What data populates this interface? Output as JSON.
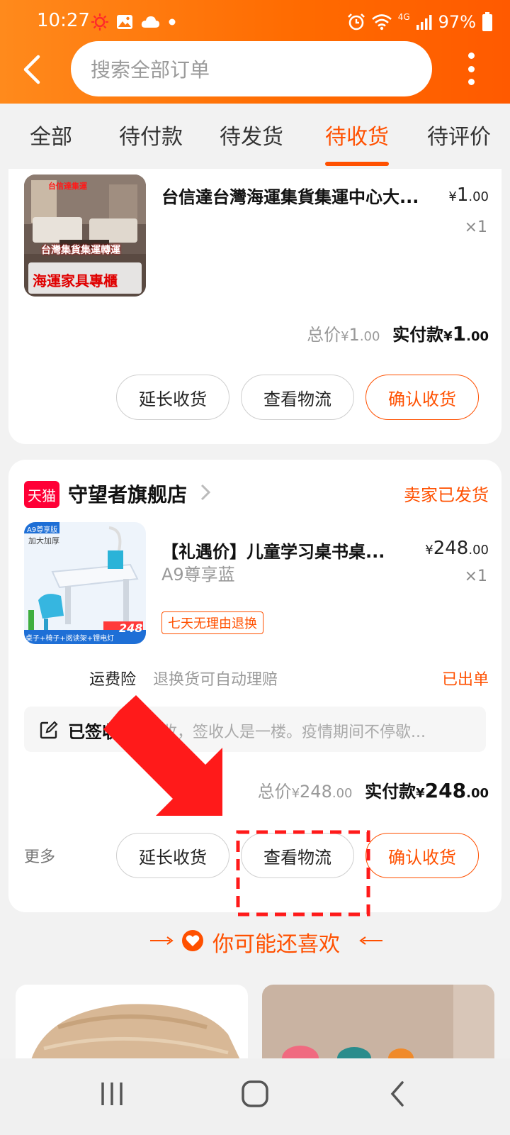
{
  "status_bar": {
    "time": "10:27",
    "battery": "97%",
    "network": "4G",
    "icons": [
      "sun-icon",
      "gallery-icon",
      "cloud-icon",
      "dot-icon",
      "alarm-icon",
      "wifi-icon",
      "signal-icon",
      "battery-icon"
    ]
  },
  "header": {
    "search_placeholder": "搜索全部订单",
    "icons": [
      "back-arrow-icon",
      "more-vertical-icon"
    ]
  },
  "tabs": [
    {
      "label": "全部",
      "active": false
    },
    {
      "label": "待付款",
      "active": false
    },
    {
      "label": "待发货",
      "active": false
    },
    {
      "label": "待收货",
      "active": true
    },
    {
      "label": "待评价",
      "active": false
    }
  ],
  "orders": [
    {
      "item": {
        "title": "台信達台灣海運集貨集運中心大...",
        "price_symbol": "¥",
        "price_int": "1",
        "price_dec": ".00",
        "qty": "×1",
        "image_text": [
          "台信達集運",
          "台灣集貨集運轉運",
          "海運家具專櫃"
        ]
      },
      "total_label": "总价",
      "total_symbol": "¥",
      "total_int": "1",
      "total_dec": ".00",
      "paid_label": "实付款",
      "paid_symbol": "¥",
      "paid_int": "1",
      "paid_dec": ".00",
      "buttons": [
        "延长收货",
        "查看物流",
        "确认收货"
      ]
    },
    {
      "shop_badge": "天猫",
      "shop_name": "守望者旗舰店",
      "status": "卖家已发货",
      "item": {
        "title": "【礼遇价】儿童学习桌书桌...",
        "price_symbol": "¥",
        "price_int": "248",
        "price_dec": ".00",
        "qty": "×1",
        "sku": "A9尊享蓝",
        "tag": "七天无理由退换",
        "image_text": [
          "A9尊享版",
          "加大加厚",
          "248",
          "桌子+椅子+阅读架+锂电灯"
        ]
      },
      "insurance_label": "运费险",
      "insurance_desc": "退换货可自动理赔",
      "insurance_status": "已出单",
      "logistics_status": "已签收",
      "logistics_detail": "已签收，签收人是一楼。疫情期间不停歇...",
      "total_label": "总价",
      "total_symbol": "¥",
      "total_int": "248",
      "total_dec": ".00",
      "paid_label": "实付款",
      "paid_symbol": "¥",
      "paid_int": "248",
      "paid_dec": ".00",
      "more_label": "更多",
      "buttons": [
        "延长收货",
        "查看物流",
        "确认收货"
      ]
    }
  ],
  "recommend": {
    "title": "你可能还喜欢"
  },
  "nav_bar": {
    "icons": [
      "recent-apps-icon",
      "home-icon",
      "back-icon"
    ]
  },
  "annotation": {
    "color": "#ff1a1a",
    "shapes": [
      "red-arrow",
      "dashed-highlight-box"
    ]
  },
  "colors": {
    "brand_orange": "#ff5000",
    "topbar_start": "#ff8a1c",
    "tmall_red": "#ff0036"
  }
}
